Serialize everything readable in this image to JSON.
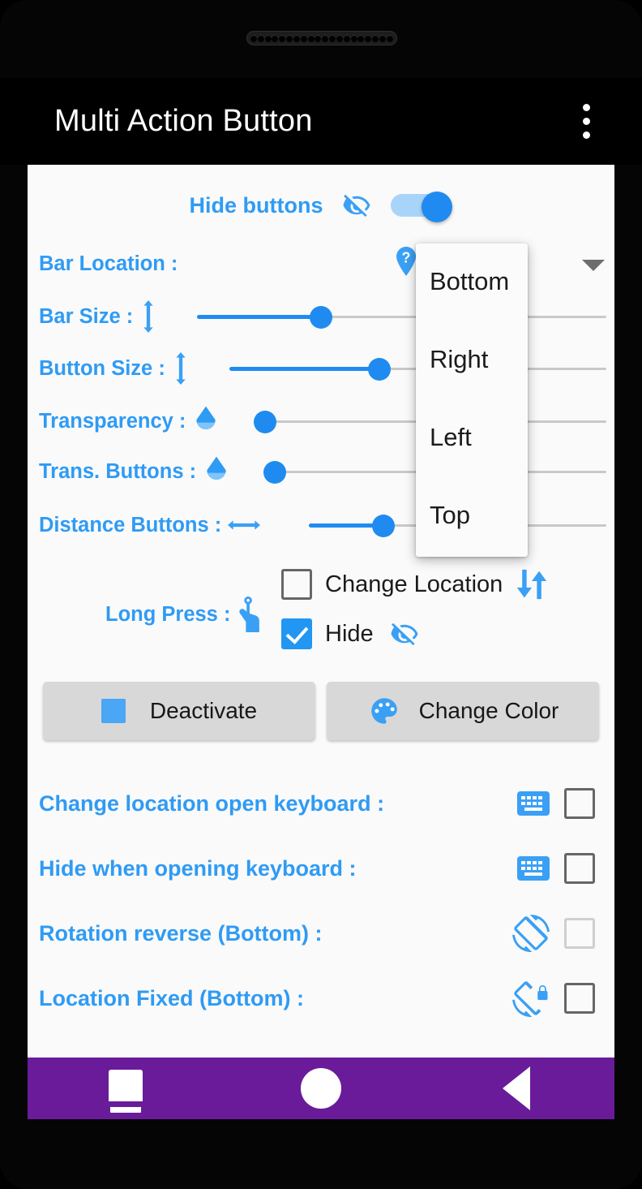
{
  "app": {
    "title": "Multi Action Button",
    "overflow_icon": "more-vert-icon"
  },
  "hide_buttons": {
    "label": "Hide buttons",
    "icon": "eye-off-icon",
    "toggle_state": "on"
  },
  "settings": [
    {
      "label": "Bar Location :",
      "icon": "help-pin-icon",
      "control": "dropdown",
      "value": "Bottom"
    },
    {
      "label": "Bar Size :",
      "icon": "resize-vertical-icon",
      "control": "slider",
      "percent": 30
    },
    {
      "label": "Button Size :",
      "icon": "resize-vertical-icon",
      "control": "slider",
      "percent": 40
    },
    {
      "label": "Transparency :",
      "icon": "water-drop-icon",
      "control": "slider",
      "percent": 0
    },
    {
      "label": "Trans. Buttons :",
      "icon": "water-drop-icon",
      "control": "slider",
      "percent": 0
    },
    {
      "label": "Distance Buttons :",
      "icon": "arrows-horizontal-icon",
      "control": "slider",
      "percent": 24
    }
  ],
  "dropdown": {
    "open": true,
    "selected": "Bottom",
    "arrow_icon": "chevron-down-icon",
    "options": [
      "Bottom",
      "Right",
      "Left",
      "Top"
    ]
  },
  "long_press": {
    "label": "Long Press :",
    "icon": "tap-hand-icon",
    "options": [
      {
        "label": "Change Location",
        "icon": "swap-vertical-icon",
        "checked": false
      },
      {
        "label": "Hide",
        "icon": "eye-off-icon",
        "checked": true
      }
    ]
  },
  "actions": [
    {
      "label": "Deactivate",
      "icon": "blue-square-icon"
    },
    {
      "label": "Change Color",
      "icon": "palette-icon"
    }
  ],
  "options": [
    {
      "label": "Change location open keyboard :",
      "icon": "keyboard-icon",
      "checked": false,
      "enabled": true
    },
    {
      "label": "Hide when opening keyboard :",
      "icon": "keyboard-icon",
      "checked": false,
      "enabled": true
    },
    {
      "label": "Rotation reverse (Bottom) :",
      "icon": "screen-rotation-icon",
      "checked": false,
      "enabled": false
    },
    {
      "label": "Location Fixed (Bottom) :",
      "icon": "screen-lock-rotation-icon",
      "checked": false,
      "enabled": true
    }
  ],
  "navbar": [
    {
      "name": "recents",
      "icon": "square-icon"
    },
    {
      "name": "home",
      "icon": "circle-icon"
    },
    {
      "name": "back",
      "icon": "triangle-left-icon"
    }
  ],
  "colors": {
    "accent": "#2f9bf4",
    "slider": "#1f8bf0",
    "card_bg": "#fafafa",
    "navbar": "#6a1b9a",
    "button_bg": "#d8d8d8"
  }
}
